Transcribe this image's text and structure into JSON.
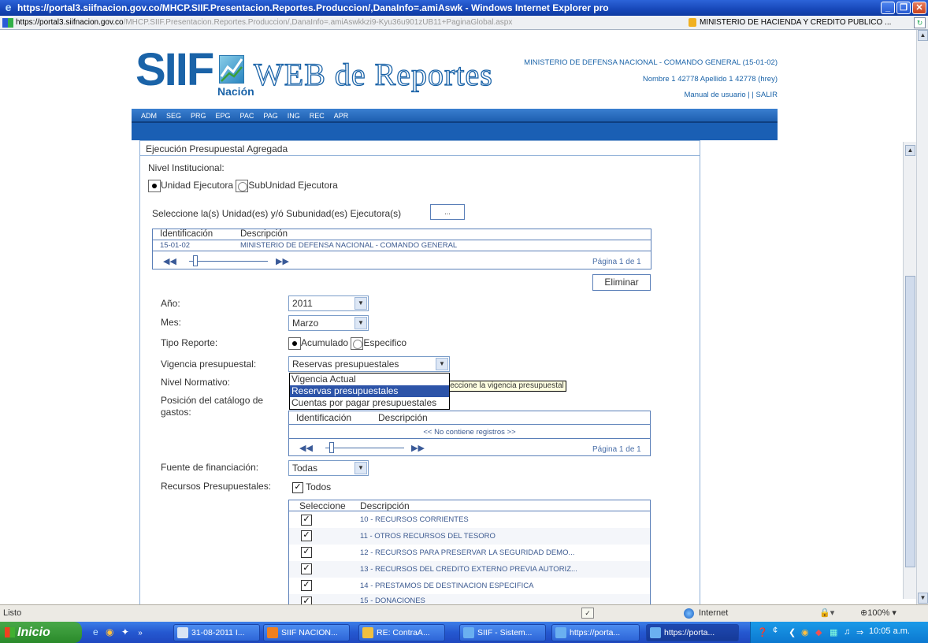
{
  "window": {
    "title": "https://portal3.siifnacion.gov.co/MHCP.SIIF.Presentacion.Reportes.Produccion/,DanaInfo=.amiAswk - Windows Internet Explorer pro",
    "minimize": "_",
    "maximize": "❐",
    "close": "✕"
  },
  "address": {
    "prefix": "https://portal3.",
    "host": "siifnacion.gov.co",
    "path": "/MHCP.SIIF.Presentacion.Reportes.Produccion/,DanaInfo=.amiAswkkzi9-Kyu36u901zUB11+PaginaGlobal.aspx",
    "certificate": "MINISTERIO DE HACIENDA Y CREDITO PUBLICO ..."
  },
  "header": {
    "logo_siif": "SIIF",
    "logo_nacion": "Nación",
    "logo_web": "WEB de Reportes",
    "org_line": "MINISTERIO DE DEFENSA NACIONAL - COMANDO GENERAL (15-01-02)",
    "user_line": "Nombre 1 42778 Apellido 1 42778 (hrey)",
    "manual_link": "Manual de usuario",
    "separator": "| |",
    "exit_link": "SALIR"
  },
  "nav": [
    "ADM",
    "SEG",
    "PRG",
    "EPG",
    "PAC",
    "PAG",
    "ING",
    "REC",
    "APR"
  ],
  "panel": {
    "title": "Ejecución Presupuestal Agregada",
    "nivel_label": "Nivel Institucional:",
    "opt_unidad": "Unidad Ejecutora",
    "opt_subunidad": "SubUnidad Ejecutora",
    "select_units_label": "Seleccione la(s) Unidad(es) y/ó Subunidad(es) Ejecutora(s)",
    "select_units_button": "...",
    "units_grid": {
      "col_id": "Identificación",
      "col_desc": "Descripción",
      "rows": [
        {
          "id": "15-01-02",
          "desc": "MINISTERIO DE DEFENSA NACIONAL - COMANDO GENERAL"
        }
      ],
      "page": "Página 1 de 1"
    },
    "eliminar": "Eliminar",
    "anio_label": "Año:",
    "anio_value": "2011",
    "mes_label": "Mes:",
    "mes_value": "Marzo",
    "tipo_label": "Tipo Reporte:",
    "tipo_acumulado": "Acumulado",
    "tipo_especifico": "Especifico",
    "vigencia_label": "Vigencia presupuestal:",
    "vigencia_value": "Reservas presupuestales",
    "vigencia_options": [
      "Vigencia Actual",
      "Reservas presupuestales",
      "Cuentas por pagar presupuestales"
    ],
    "vigencia_tooltip": "leccione la vigencia presupuestal",
    "nivel_normativo_label": "Nivel Normativo:",
    "posicion_label_1": "Posición del catálogo de",
    "posicion_label_2": "gastos:",
    "gastos_grid": {
      "col_id": "Identificación",
      "col_desc": "Descripción",
      "empty": "<< No contiene registros >>",
      "page": "Página 1 de 1"
    },
    "fuente_label": "Fuente de financiación:",
    "fuente_value": "Todas",
    "recursos_label": "Recursos Presupuestales:",
    "todos_label": "Todos",
    "recursos_grid": {
      "col_sel": "Seleccione",
      "col_desc": "Descripción",
      "rows": [
        "10 - RECURSOS CORRIENTES",
        "11 - OTROS RECURSOS DEL TESORO",
        "12 - RECURSOS PARA PRESERVAR LA SEGURIDAD DEMO...",
        "13 - RECURSOS DEL CREDITO EXTERNO PREVIA AUTORIZ...",
        "14 - PRESTAMOS DE DESTINACION ESPECIFICA",
        "15 - DONACIONES"
      ]
    }
  },
  "status": {
    "text": "Listo",
    "zone": "Internet",
    "zoom": "100%"
  },
  "taskbar": {
    "start": "Inicio",
    "tasks": [
      "31-08-2011 I...",
      "SIIF NACION...",
      "RE: ContraA...",
      "SIIF - Sistem...",
      "https://porta...",
      "https://porta..."
    ],
    "clock": "10:05 a.m."
  },
  "colors": {
    "brand_blue": "#1a63a8",
    "nav_blue": "#1e5fb0",
    "xp_title": "#1747b8",
    "selection": "#2d54a8"
  }
}
